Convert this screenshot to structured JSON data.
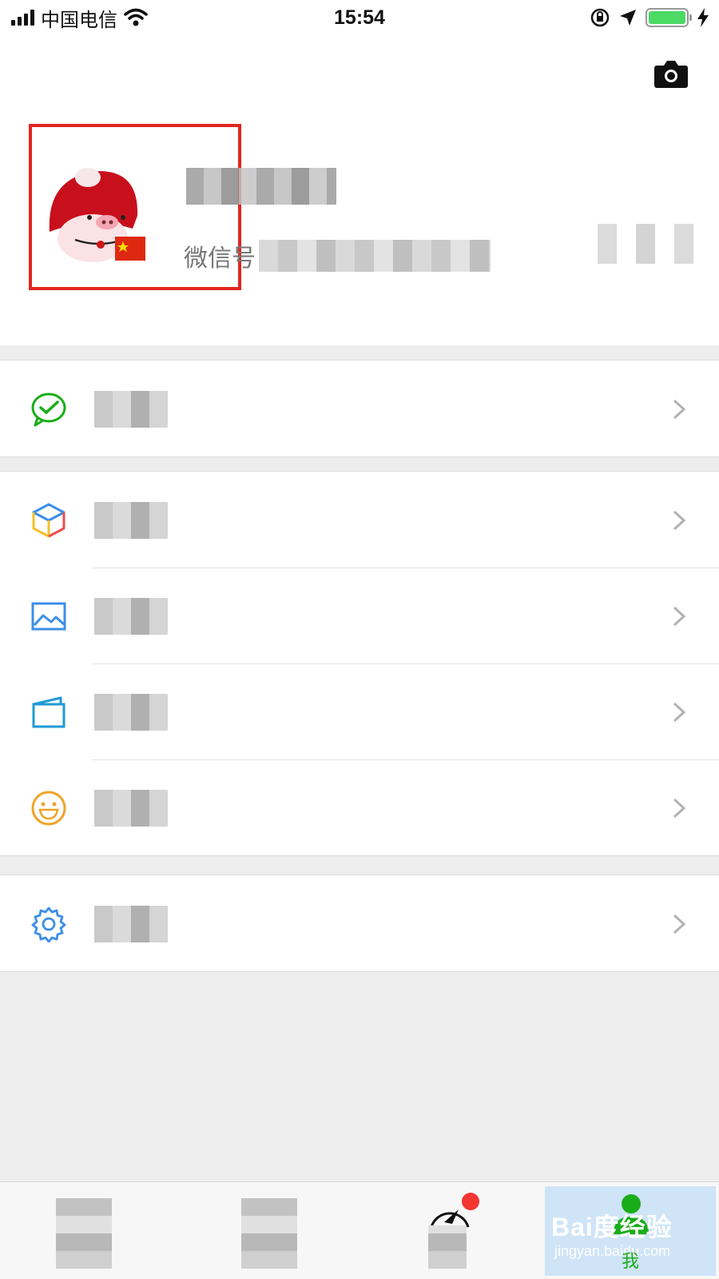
{
  "status_bar": {
    "carrier": "中国电信",
    "time": "15:54"
  },
  "profile": {
    "wechat_id_prefix": "微信号"
  },
  "menu_groups": [
    {
      "items": [
        {
          "icon": "wechat-pay-icon",
          "label": ""
        }
      ]
    },
    {
      "items": [
        {
          "icon": "favorites-cube-icon",
          "label": ""
        },
        {
          "icon": "album-icon",
          "label": ""
        },
        {
          "icon": "cards-wallet-icon",
          "label": ""
        },
        {
          "icon": "sticker-smiley-icon",
          "label": ""
        }
      ]
    },
    {
      "items": [
        {
          "icon": "settings-gear-icon",
          "label": ""
        }
      ]
    }
  ],
  "tabbar": {
    "active_tab_label": "我",
    "watermark_text": "Bai度经验",
    "watermark_url": "jingyan.baidu.com"
  },
  "colors": {
    "highlight_box": "#e0261f",
    "wechat_green": "#1aad19",
    "badge_red": "#f43530"
  }
}
